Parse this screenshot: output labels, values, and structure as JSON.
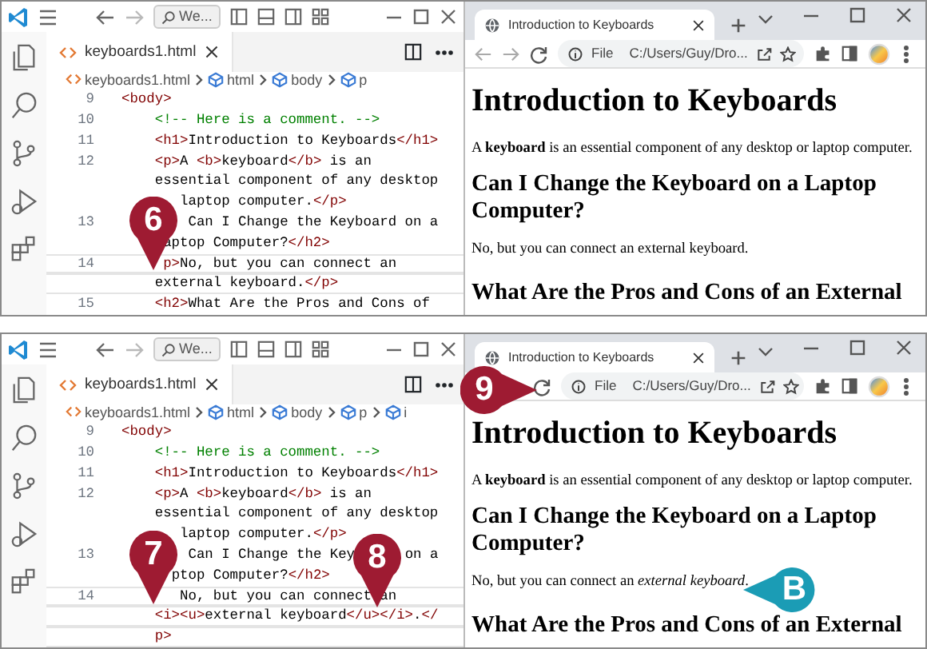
{
  "panels": [
    {
      "editor": {
        "search": "We...",
        "tab": "keyboards1.html",
        "breadcrumbs": [
          "keyboards1.html",
          "html",
          "body",
          "p"
        ],
        "lines": [
          {
            "number": "9",
            "current": false,
            "rows": [
              {
                "tokens": [
                  {
                    "kind": "tag",
                    "text": "<body>"
                  }
                ]
              }
            ]
          },
          {
            "number": "10",
            "current": false,
            "rows": [
              {
                "tokens": [
                  {
                    "kind": "comment",
                    "text": "    <!-- Here is a comment. -->"
                  }
                ]
              }
            ]
          },
          {
            "number": "11",
            "current": false,
            "rows": [
              {
                "tokens": [
                  {
                    "kind": "tag",
                    "text": "    <h1>"
                  },
                  {
                    "kind": "text",
                    "text": "Introduction to Keyboards"
                  },
                  {
                    "kind": "tag",
                    "text": "</h1>"
                  }
                ]
              }
            ]
          },
          {
            "number": "12",
            "current": false,
            "rows": [
              {
                "tokens": [
                  {
                    "kind": "tag",
                    "text": "    <p>"
                  },
                  {
                    "kind": "text",
                    "text": "A "
                  },
                  {
                    "kind": "tag",
                    "text": "<b>"
                  },
                  {
                    "kind": "text",
                    "text": "keyboard"
                  },
                  {
                    "kind": "tag",
                    "text": "</b>"
                  },
                  {
                    "kind": "text",
                    "text": " is an"
                  }
                ]
              },
              {
                "tokens": [
                  {
                    "kind": "text",
                    "text": "    essential component of any desktop"
                  }
                ]
              },
              {
                "tokens": [
                  {
                    "kind": "text",
                    "text": "       laptop computer."
                  },
                  {
                    "kind": "tag",
                    "text": "</p>"
                  }
                ]
              }
            ]
          },
          {
            "number": "13",
            "current": false,
            "rows": [
              {
                "tokens": [
                  {
                    "kind": "text",
                    "text": "        Can I Change the Keyboard on a"
                  }
                ]
              },
              {
                "tokens": [
                  {
                    "kind": "text",
                    "text": "     aptop Computer?"
                  },
                  {
                    "kind": "tag",
                    "text": "</h2>"
                  }
                ]
              }
            ]
          },
          {
            "number": "14",
            "current": true,
            "rows": [
              {
                "tokens": [
                  {
                    "kind": "tag",
                    "text": "     p>"
                  },
                  {
                    "kind": "text",
                    "text": "No, but you can connect an"
                  }
                ]
              },
              {
                "tokens": [
                  {
                    "kind": "text",
                    "text": "    external keyboard."
                  },
                  {
                    "kind": "tag",
                    "text": "</p>"
                  }
                ]
              }
            ]
          },
          {
            "number": "15",
            "current": false,
            "rows": [
              {
                "tokens": [
                  {
                    "kind": "tag",
                    "text": "    <h2>"
                  },
                  {
                    "kind": "text",
                    "text": "What Are the Pros and Cons of"
                  }
                ]
              }
            ]
          }
        ]
      },
      "browser": {
        "tab_title": "Introduction to Keyboards",
        "scheme": "File",
        "url": "C:/Users/Guy/Dro...",
        "content": [
          {
            "kind": "h1",
            "text": "Introduction to Keyboards"
          },
          {
            "kind": "p",
            "text": "A **keyboard** is an essential component of any desktop or laptop computer."
          },
          {
            "kind": "h2",
            "text": "Can I Change the Keyboard on a Laptop Computer?"
          },
          {
            "kind": "p",
            "text": "No, but you can connect an external keyboard."
          },
          {
            "kind": "h2",
            "text": "What Are the Pros and Cons of an External"
          }
        ]
      },
      "callouts": [
        {
          "label": "6",
          "color": "#9e1b32",
          "kind": "pin-down"
        }
      ]
    },
    {
      "editor": {
        "search": "We...",
        "tab": "keyboards1.html",
        "breadcrumbs": [
          "keyboards1.html",
          "html",
          "body",
          "p",
          "i"
        ],
        "lines": [
          {
            "number": "9",
            "current": false,
            "rows": [
              {
                "tokens": [
                  {
                    "kind": "tag",
                    "text": "<body>"
                  }
                ]
              }
            ]
          },
          {
            "number": "10",
            "current": false,
            "rows": [
              {
                "tokens": [
                  {
                    "kind": "comment",
                    "text": "    <!-- Here is a comment. -->"
                  }
                ]
              }
            ]
          },
          {
            "number": "11",
            "current": false,
            "rows": [
              {
                "tokens": [
                  {
                    "kind": "tag",
                    "text": "    <h1>"
                  },
                  {
                    "kind": "text",
                    "text": "Introduction to Keyboards"
                  },
                  {
                    "kind": "tag",
                    "text": "</h1>"
                  }
                ]
              }
            ]
          },
          {
            "number": "12",
            "current": false,
            "rows": [
              {
                "tokens": [
                  {
                    "kind": "tag",
                    "text": "    <p>"
                  },
                  {
                    "kind": "text",
                    "text": "A "
                  },
                  {
                    "kind": "tag",
                    "text": "<b>"
                  },
                  {
                    "kind": "text",
                    "text": "keyboard"
                  },
                  {
                    "kind": "tag",
                    "text": "</b>"
                  },
                  {
                    "kind": "text",
                    "text": " is an"
                  }
                ]
              },
              {
                "tokens": [
                  {
                    "kind": "text",
                    "text": "    essential component of any desktop"
                  }
                ]
              },
              {
                "tokens": [
                  {
                    "kind": "text",
                    "text": "       laptop computer."
                  },
                  {
                    "kind": "tag",
                    "text": "</p>"
                  }
                ]
              }
            ]
          },
          {
            "number": "13",
            "current": false,
            "rows": [
              {
                "tokens": [
                  {
                    "kind": "text",
                    "text": "        Can I Change the Key"
                  },
                  {
                    "kind": "text",
                    "text": "      on a"
                  }
                ]
              },
              {
                "tokens": [
                  {
                    "kind": "text",
                    "text": "      ptop Computer?"
                  },
                  {
                    "kind": "tag",
                    "text": "</h2>"
                  }
                ]
              }
            ]
          },
          {
            "number": "14",
            "current": true,
            "rows": [
              {
                "tokens": [
                  {
                    "kind": "text",
                    "text": "       No, but you can connect an"
                  }
                ]
              },
              {
                "tokens": [
                  {
                    "kind": "tag",
                    "text": "    <i><u>"
                  },
                  {
                    "kind": "text",
                    "text": "external keyboard"
                  },
                  {
                    "kind": "tag",
                    "text": "</u></i>"
                  },
                  {
                    "kind": "text",
                    "text": "."
                  },
                  {
                    "kind": "tag",
                    "text": "</"
                  }
                ]
              },
              {
                "tokens": [
                  {
                    "kind": "tag",
                    "text": "    p>"
                  }
                ]
              }
            ]
          }
        ]
      },
      "browser": {
        "tab_title": "Introduction to Keyboards",
        "scheme": "File",
        "url": "C:/Users/Guy/Dro...",
        "content": [
          {
            "kind": "h1",
            "text": "Introduction to Keyboards"
          },
          {
            "kind": "p",
            "text": "A **keyboard** is an essential component of any desktop or laptop computer."
          },
          {
            "kind": "h2",
            "text": "Can I Change the Keyboard on a Laptop Computer?"
          },
          {
            "kind": "p",
            "text": "No, but you can connect an *external keyboard*."
          },
          {
            "kind": "h2",
            "text": "What Are the Pros and Cons of an External"
          }
        ]
      },
      "callouts": [
        {
          "label": "7",
          "color": "#9e1b32",
          "kind": "pin-down"
        },
        {
          "label": "8",
          "color": "#9e1b32",
          "kind": "pin-down"
        },
        {
          "label": "9",
          "color": "#9e1b32",
          "kind": "pin-right"
        },
        {
          "label": "B",
          "color": "#1b9cb5",
          "kind": "pin-left"
        }
      ]
    }
  ]
}
